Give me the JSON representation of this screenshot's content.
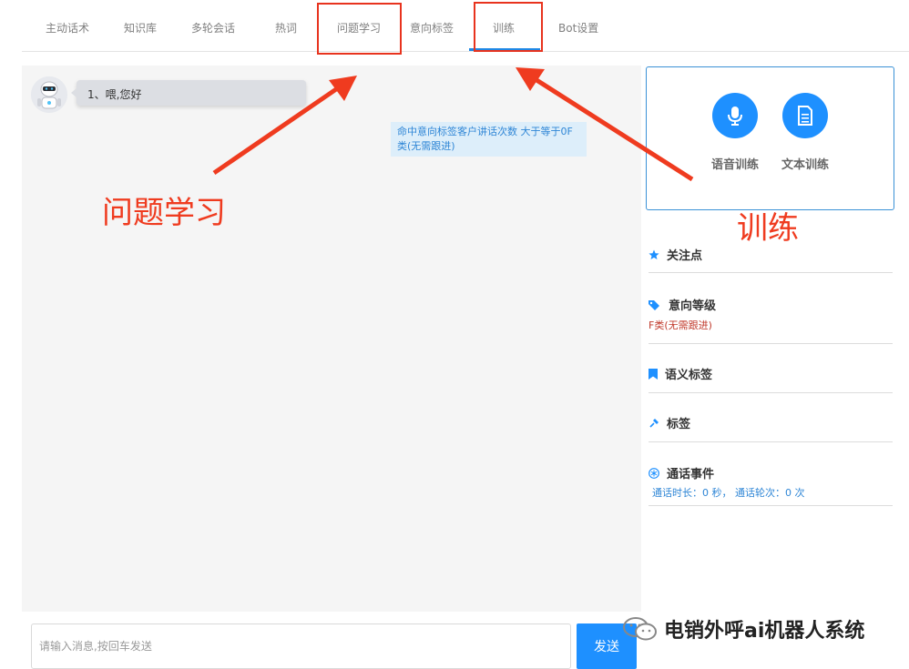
{
  "tabs": [
    {
      "label": "主动话术"
    },
    {
      "label": "知识库"
    },
    {
      "label": "多轮会话"
    },
    {
      "label": "热词"
    },
    {
      "label": "问题学习"
    },
    {
      "label": "意向标签"
    },
    {
      "label": "训练"
    },
    {
      "label": "Bot设置"
    }
  ],
  "chat": {
    "bot_message": "1、喂,您好",
    "hit_note": "命中意向标签客户讲话次数 大于等于0F类(无需跟进)",
    "input_placeholder": "请输入消息,按回车发送",
    "send_label": "发送"
  },
  "training": {
    "voice_label": "语音训练",
    "text_label": "文本训练"
  },
  "sections": {
    "focus": {
      "title": "关注点"
    },
    "intent": {
      "title": "意向等级",
      "value": "F类(无需跟进)"
    },
    "semantic": {
      "title": "语义标签"
    },
    "tags": {
      "title": "标签"
    },
    "call": {
      "title": "通话事件",
      "value": "通话时长：0 秒， 通话轮次：0 次"
    }
  },
  "annotations": {
    "left_label": "问题学习",
    "right_label": "训练"
  },
  "watermark": {
    "text": "电销外呼ai机器人系统"
  },
  "colors": {
    "accent": "#1e90ff",
    "annotation_red": "#ef3b1f",
    "intent_red": "#c0392b",
    "call_blue": "#2f86d6"
  }
}
